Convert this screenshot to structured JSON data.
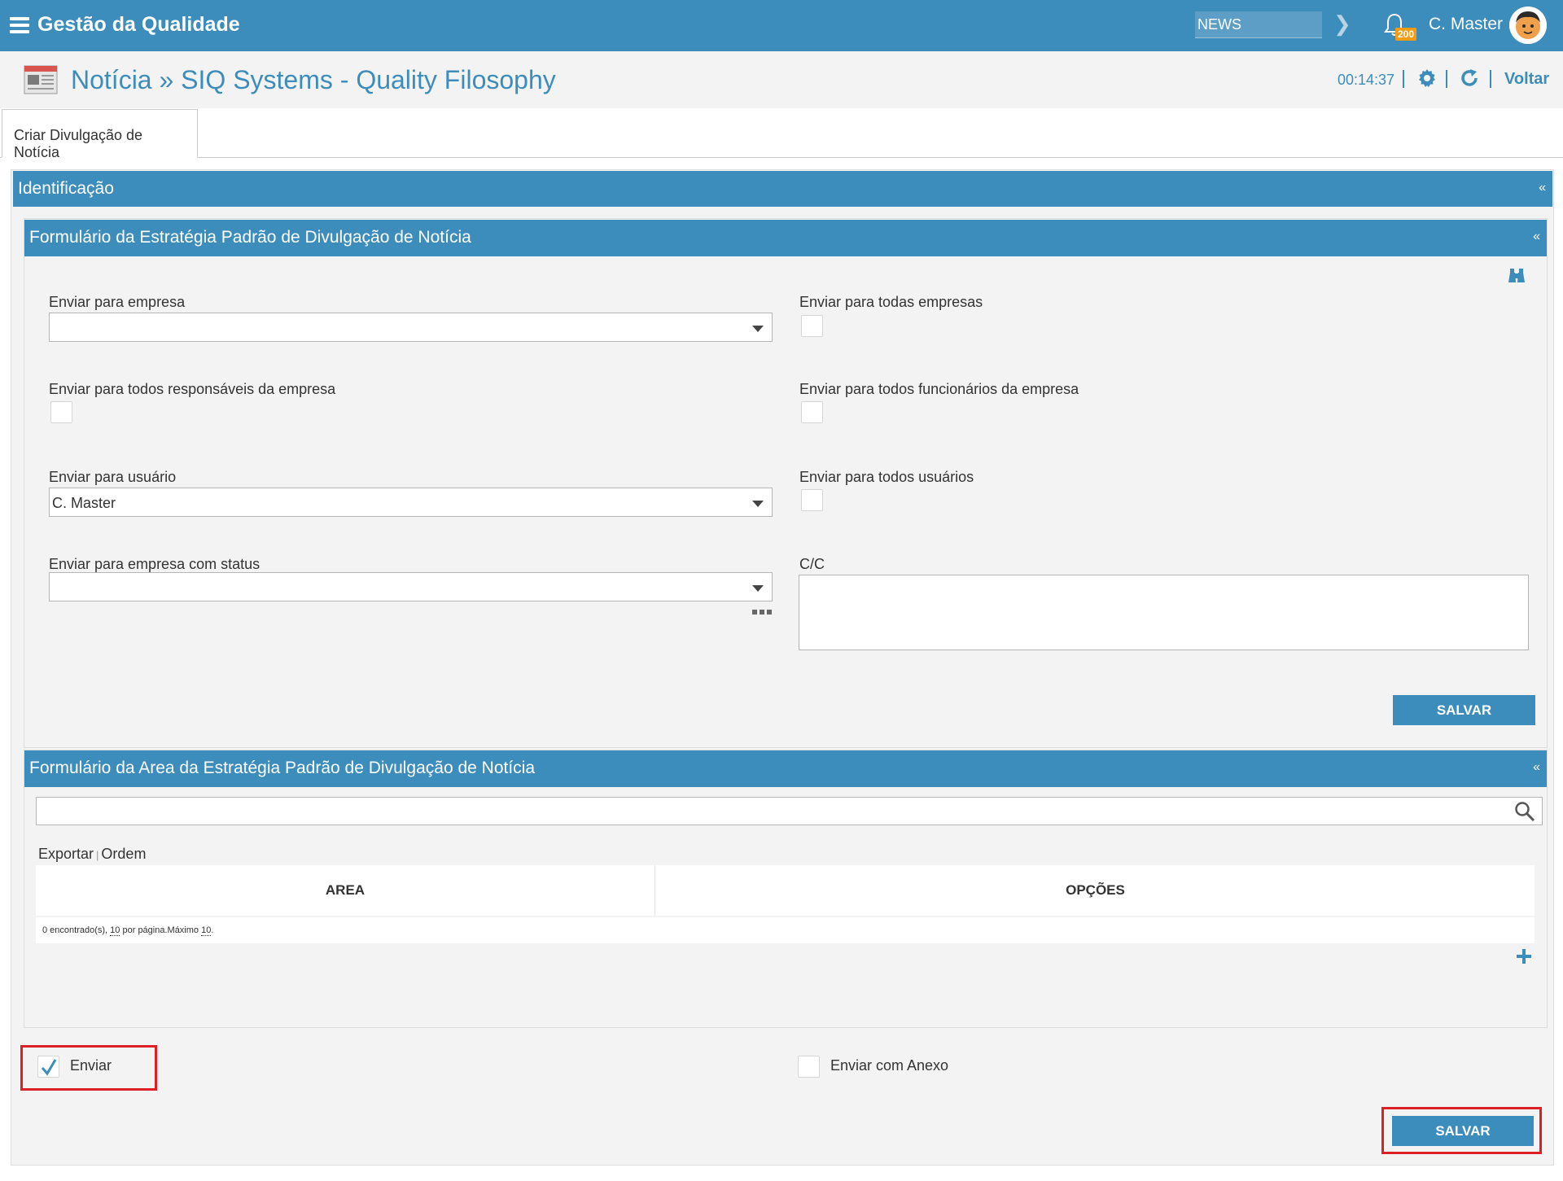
{
  "topbar": {
    "app_title": "Gestão da Qualidade",
    "news_value": "NEWS",
    "notification_count": "200",
    "user_name": "C. Master"
  },
  "page": {
    "title": "Notícia » SIQ Systems - Quality Filosophy",
    "timer": "00:14:37",
    "back_label": "Voltar"
  },
  "tab": {
    "label": "Criar Divulgação de Notícia"
  },
  "section_identificacao": {
    "title": "Identificação",
    "collapse": "«"
  },
  "form_estrategia": {
    "title": "Formulário da Estratégia Padrão de Divulgação de Notícia",
    "collapse": "«",
    "enviar_empresa_label": "Enviar para empresa",
    "enviar_empresa_value": "",
    "todas_empresas_label": "Enviar para todas empresas",
    "todos_responsaveis_label": "Enviar para todos responsáveis da empresa",
    "todos_funcionarios_label": "Enviar para todos funcionários da empresa",
    "enviar_usuario_label": "Enviar para usuário",
    "enviar_usuario_value": "C. Master",
    "todos_usuarios_label": "Enviar para todos usuários",
    "empresa_status_label": "Enviar para empresa com status",
    "empresa_status_value": "",
    "cc_label": "C/C",
    "cc_value": "",
    "save_label": "SALVAR"
  },
  "form_area": {
    "title": "Formulário da Area da Estratégia Padrão de Divulgação de Notícia",
    "collapse": "«",
    "search_value": "",
    "exportar_label": "Exportar",
    "ordem_label": "Ordem",
    "columns": [
      "AREA",
      "OPÇÕES"
    ],
    "footer_count": "0 encontrado(s),",
    "footer_per_page_num": "10",
    "footer_per_page_text": "por página.Máximo",
    "footer_max_num": "10",
    "footer_period": "."
  },
  "bottom": {
    "enviar_label": "Enviar",
    "enviar_checked": true,
    "enviar_anexo_label": "Enviar com Anexo",
    "enviar_anexo_checked": false,
    "save_label": "SALVAR"
  },
  "colors": {
    "primary": "#3c8dbc",
    "badge": "#f39c12",
    "highlight": "#dd2025",
    "panel_bg": "#f3f3f3"
  }
}
